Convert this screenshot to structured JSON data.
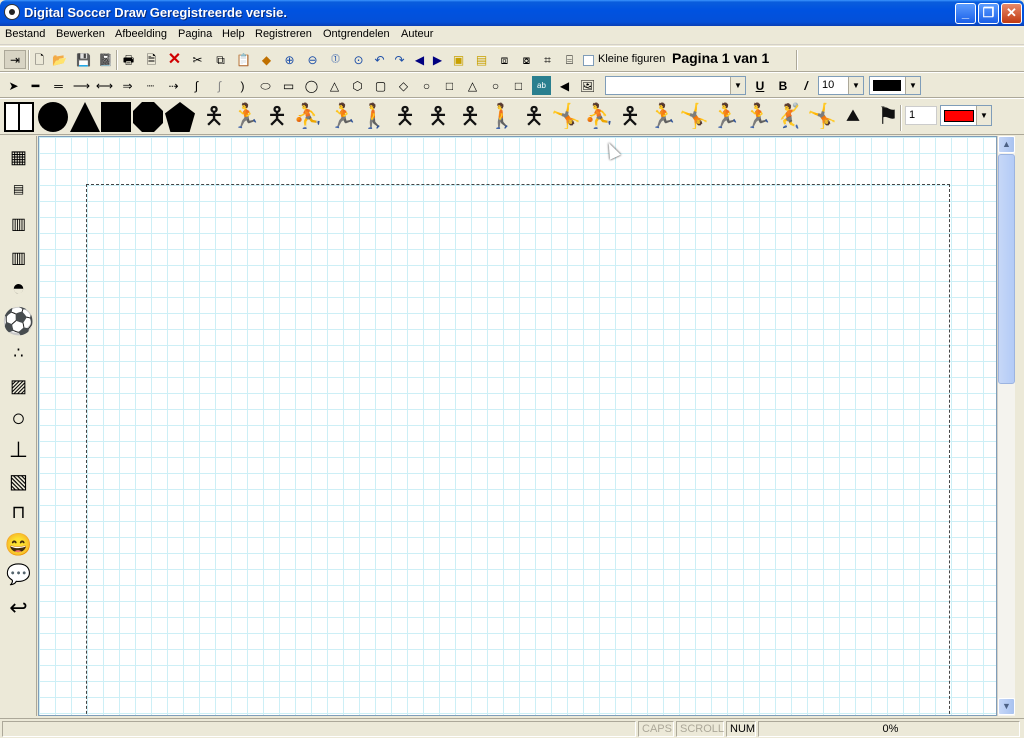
{
  "window": {
    "title": "Digital Soccer Draw  Geregistreerde versie."
  },
  "window_controls": {
    "minimize": "_",
    "maximize": "❐",
    "close": "✕"
  },
  "menu": [
    "Bestand",
    "Bewerken",
    "Afbeelding",
    "Pagina",
    "Help",
    "Registreren",
    "Ontgrendelen",
    "Auteur"
  ],
  "toolbar_main": {
    "small_figures_label": "Kleine figuren",
    "small_figures_checked": false,
    "page_indicator": "Pagina 1 van 1"
  },
  "toolbar_format": {
    "font_name": "",
    "underline": "U",
    "bold": "B",
    "italic": "/",
    "font_size": "10",
    "text_color": "#000000"
  },
  "toolbar_players": {
    "line_width": "1",
    "stroke_color": "#ff0000"
  },
  "statusbar": {
    "caps": "CAPS",
    "scroll": "SCROLL",
    "num": "NUM",
    "progress": "0%"
  }
}
